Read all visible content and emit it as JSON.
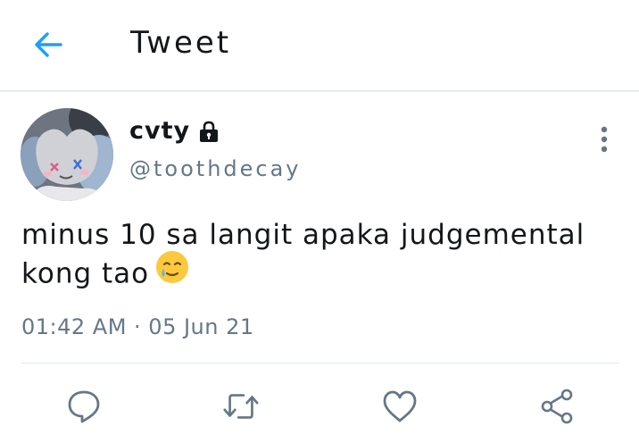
{
  "header": {
    "title": "Tweet",
    "back_icon": "arrow-left-icon",
    "accent_color": "#1da1f2"
  },
  "tweet": {
    "author": {
      "display_name": "cvty",
      "handle": "@toothdecay",
      "protected_icon": "lock-icon"
    },
    "text": "minus 10 sa langit apaka judgemental kong tao",
    "emoji": "smiling-face-with-tear",
    "timestamp": "01:42 AM · 05 Jun 21"
  },
  "actions": [
    {
      "name": "reply",
      "icon": "speech-bubble-icon"
    },
    {
      "name": "retweet",
      "icon": "retweet-icon"
    },
    {
      "name": "like",
      "icon": "heart-icon"
    },
    {
      "name": "share",
      "icon": "share-icon"
    }
  ],
  "colors": {
    "text": "#14171a",
    "secondary": "#657786",
    "icon": "#657786",
    "border": "#e6ecf0"
  }
}
